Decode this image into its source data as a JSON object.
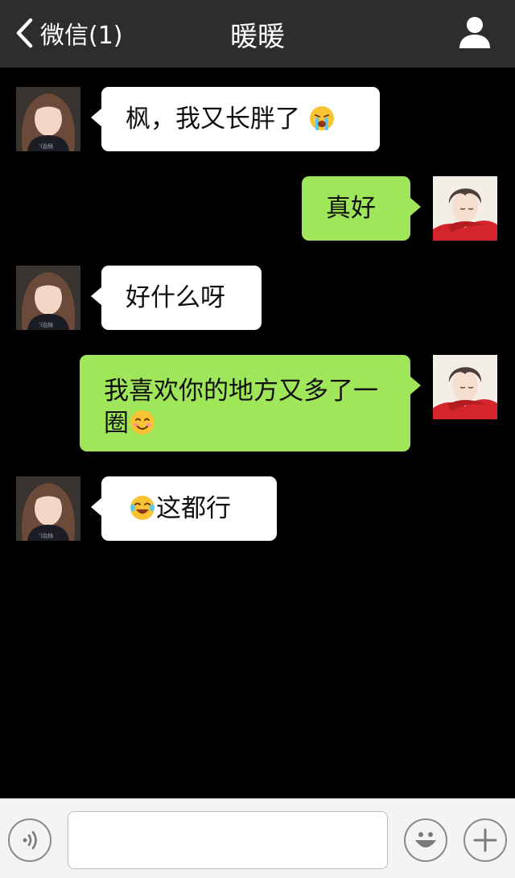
{
  "header": {
    "back_label": "微信(1)",
    "title": "暖暖"
  },
  "messages": [
    {
      "side": "left",
      "text": "枫，我又长胖了",
      "emoji": "crying-face"
    },
    {
      "side": "right",
      "text": "真好"
    },
    {
      "side": "left",
      "text": "好什么呀"
    },
    {
      "side": "right",
      "text_line1": "我喜欢你的地方又多了一",
      "text_line2": "圈",
      "emoji": "blushing-smile"
    },
    {
      "side": "left",
      "text": "这都行",
      "emoji": "tears-of-joy"
    }
  ],
  "input_bar": {
    "voice_icon": "voice-icon",
    "emoji_icon": "smiley-icon",
    "add_icon": "plus-icon"
  },
  "colors": {
    "topbar": "#2d2d30",
    "background": "#000000",
    "incoming_bubble": "#ffffff",
    "outgoing_bubble": "#9fe65a",
    "input_bar": "#f4f4f6"
  }
}
